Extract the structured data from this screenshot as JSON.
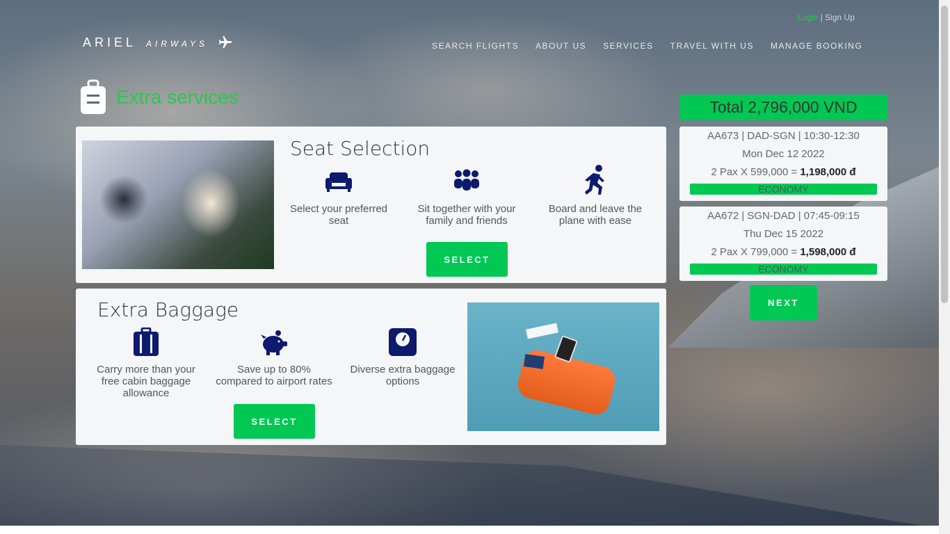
{
  "header": {
    "login": "Login",
    "separator": " | ",
    "signup": "Sign Up",
    "brand": "ARIEL",
    "brand_sub": "AIRWAYS",
    "nav": [
      "SEARCH FLIGHTS",
      "ABOUT US",
      "SERVICES",
      "TRAVEL WITH US",
      "MANAGE BOOKING"
    ]
  },
  "page": {
    "title": "Extra services"
  },
  "seat": {
    "title": "Seat Selection",
    "features": [
      {
        "icon": "sofa-icon",
        "text": "Select your preferred seat"
      },
      {
        "icon": "group-icon",
        "text": "Sit together with your family and friends"
      },
      {
        "icon": "running-person-icon",
        "text": "Board and leave the plane with ease"
      }
    ],
    "button": "SELECT"
  },
  "baggage": {
    "title": "Extra Baggage",
    "features": [
      {
        "icon": "suitcase-icon",
        "text": "Carry more than your free cabin baggage allowance"
      },
      {
        "icon": "piggy-bank-icon",
        "text": "Save up to 80% compared to airport rates"
      },
      {
        "icon": "scale-icon",
        "text": "Diverse extra baggage options"
      }
    ],
    "button": "SELECT"
  },
  "summary": {
    "total": "Total 2,796,000 VND",
    "flights": [
      {
        "route": "AA673 | DAD-SGN | 10:30-12:30",
        "date": "Mon Dec 12 2022",
        "pax": "2 Pax X 599,000 = ",
        "amount": "1,198,000 đ",
        "class": "ECONOMY"
      },
      {
        "route": "AA672 | SGN-DAD | 07:45-09:15",
        "date": "Thu Dec 15 2022",
        "pax": "2 Pax X 799,000 = ",
        "amount": "1,598,000 đ",
        "class": "ECONOMY"
      }
    ],
    "next": "NEXT"
  },
  "colors": {
    "accent": "#00c853",
    "title_green": "#2cc650",
    "icon_navy": "#0d1a6e"
  }
}
